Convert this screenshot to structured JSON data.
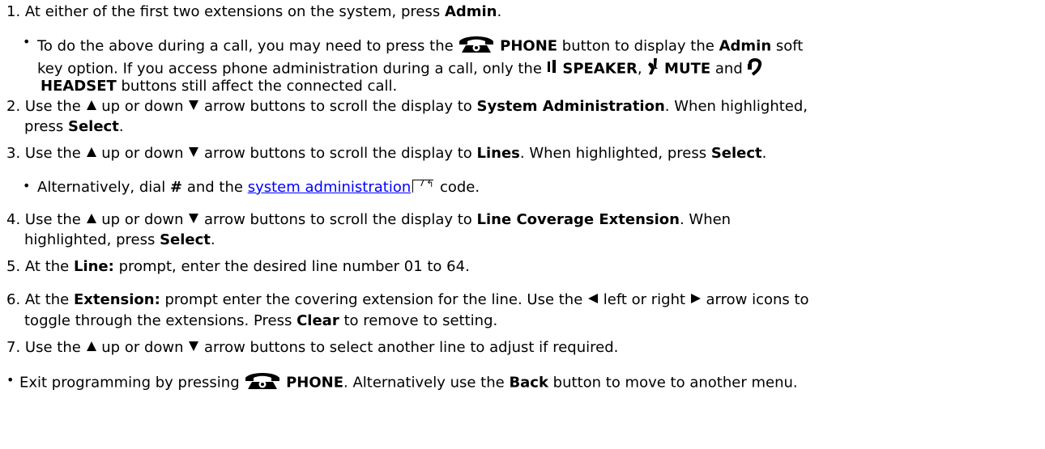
{
  "steps": {
    "s1": {
      "num": "1.",
      "pre": "At either of the first two extensions on the system, press ",
      "b1": "Admin",
      "post": "."
    },
    "s1a": {
      "pre": "To do the above during a call, you may need to press the ",
      "phone": "PHONE",
      "mid": " button to display the ",
      "admin": "Admin",
      "post": " soft",
      "l2pre": "key option. If you access phone administration during a call, only the ",
      "speaker": "SPEAKER",
      "comma": ", ",
      "mute": "MUTE",
      "and": " and ",
      "headset": "HEADSET",
      "l3post": " buttons still affect the connected call."
    },
    "s2": {
      "num": "2.",
      "pre": "Use the ",
      "up": " up or down ",
      "arrows": " arrow buttons to scroll the display to ",
      "target": "System Administration",
      "post": ". When highlighted,",
      "l2pre": "press ",
      "select": "Select",
      "l2post": "."
    },
    "s3": {
      "num": "3.",
      "pre": "Use the ",
      "up": " up or down ",
      "arrows": " arrow buttons to scroll the display to ",
      "target": "Lines",
      "mid": ". When highlighted, press ",
      "select": "Select",
      "post": "."
    },
    "s3a": {
      "pre": "Alternatively, dial ",
      "hash": "#",
      "mid": " and the ",
      "link": "system administration",
      "xref": "7",
      "post": " code."
    },
    "s4": {
      "num": "4.",
      "pre": "Use the ",
      "up": " up or down ",
      "arrows": " arrow buttons to scroll the display to ",
      "target": "Line Coverage Extension",
      "post": ". When",
      "l2pre": "highlighted, press ",
      "select": "Select",
      "l2post": "."
    },
    "s5": {
      "num": "5.",
      "pre": "At the ",
      "b1": "Line:",
      "post": " prompt, enter the desired line number 01 to 64."
    },
    "s6": {
      "num": "6.",
      "pre": "At the ",
      "b1": "Extension:",
      "mid": " prompt enter the covering extension for the line. Use the ",
      "left": " left or right ",
      "post": " arrow icons to",
      "l2pre": "toggle through the extensions. Press ",
      "clear": "Clear",
      "l2post": " to remove to setting."
    },
    "s7": {
      "num": "7.",
      "pre": "Use the ",
      "up": " up or down ",
      "post": " arrow buttons to select another line to adjust if required."
    },
    "exit": {
      "pre": "Exit programming by pressing ",
      "phone": "PHONE",
      "mid": ". Alternatively use the ",
      "back": "Back",
      "post": " button to move to another menu."
    }
  },
  "icons": {
    "phone": "phone-icon",
    "speaker": "speaker-icon",
    "mute": "mute-icon",
    "headset": "headset-icon",
    "up": "up-arrow-icon",
    "down": "down-arrow-icon",
    "left": "left-arrow-icon",
    "right": "right-arrow-icon"
  }
}
